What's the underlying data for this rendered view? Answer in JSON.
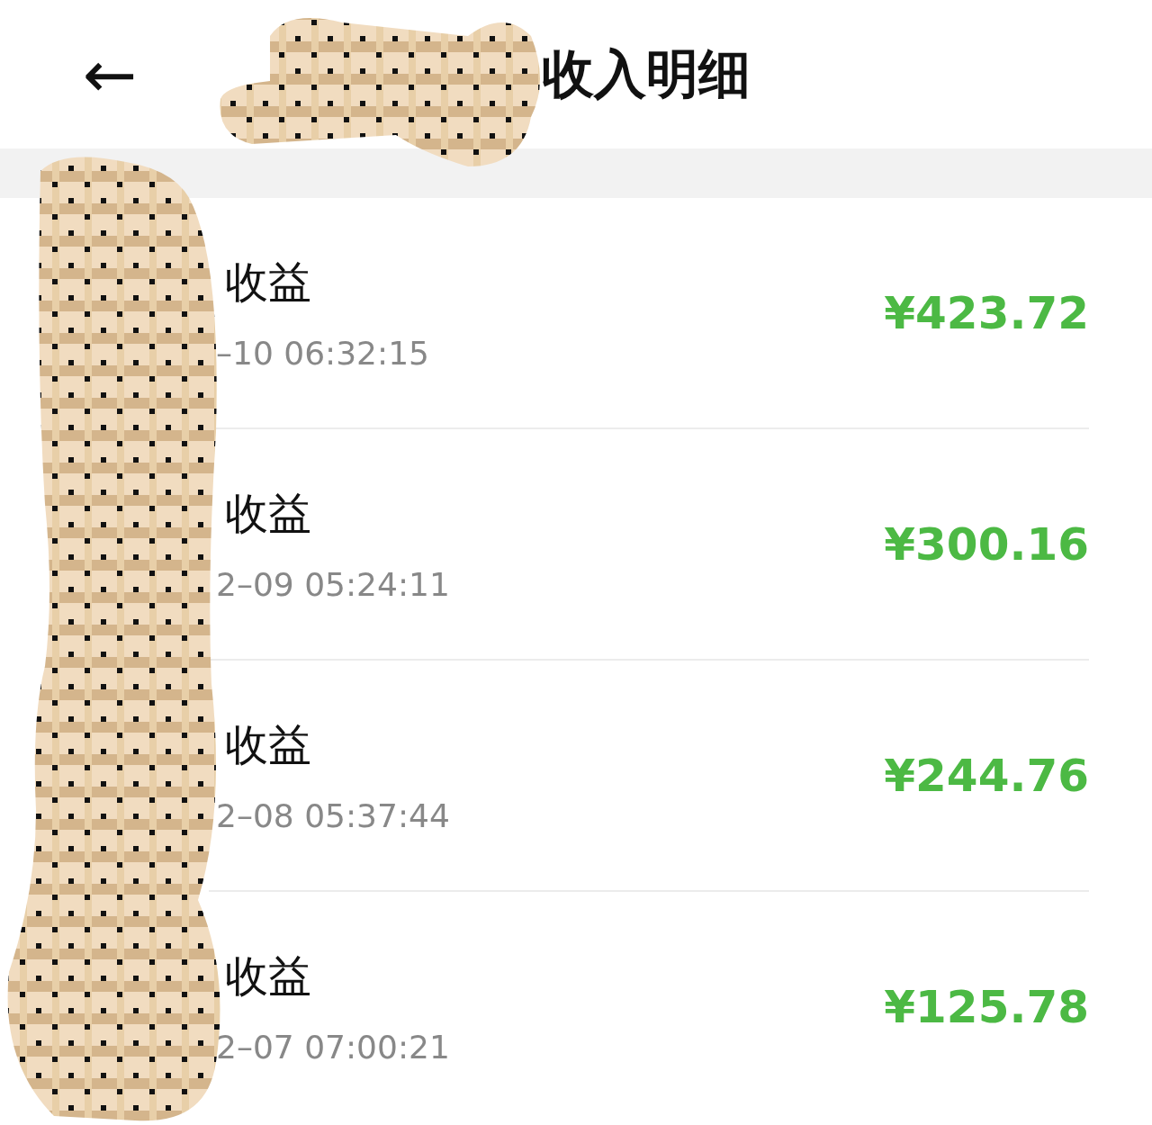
{
  "header": {
    "back": "←",
    "title": "收入明细"
  },
  "records": [
    {
      "title": "收益",
      "time": "–10 06:32:15",
      "amount": "¥423.72"
    },
    {
      "title": "收益",
      "time": "2–09 05:24:11",
      "amount": "¥300.16"
    },
    {
      "title": "收益",
      "time": "2–08 05:37:44",
      "amount": "¥244.76"
    },
    {
      "title": "收益",
      "time": "2–07 07:00:21",
      "amount": "¥125.78"
    }
  ]
}
